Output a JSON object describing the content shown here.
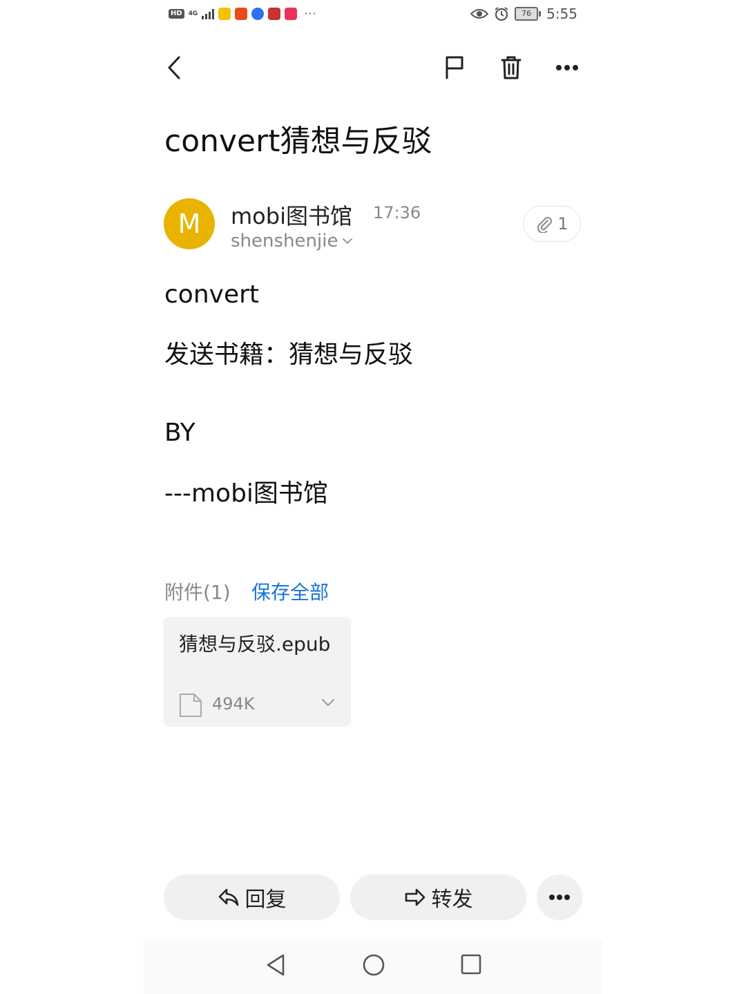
{
  "status_bar": {
    "network": "4G",
    "hd_badge": "HD",
    "battery": "76",
    "time": "5:55",
    "overflow": "···",
    "icons": [
      "signal-icon",
      "app-notification-icons",
      "eye-icon",
      "alarm-icon",
      "battery-icon"
    ]
  },
  "toolbar": {
    "icons": [
      "back-icon",
      "flag-icon",
      "trash-icon",
      "more-icon"
    ]
  },
  "email": {
    "subject": "convert猜想与反驳",
    "sender": {
      "avatar_letter": "M",
      "name": "mobi图书馆",
      "time": "17:36",
      "recipient": "shenshenjie"
    },
    "attachment_count": "1",
    "body": [
      "convert",
      "发送书籍：猜想与反驳",
      "BY",
      "---mobi图书馆"
    ]
  },
  "attachments": {
    "label": "附件(1)",
    "save_all": "保存全部",
    "items": [
      {
        "name": "猜想与反驳.epub",
        "size": "494K"
      }
    ]
  },
  "actions": {
    "reply": "回复",
    "forward": "转发"
  },
  "colors": {
    "avatar": "#e8b400",
    "link": "#1a73d9",
    "button_bg": "#f0f0f0"
  }
}
